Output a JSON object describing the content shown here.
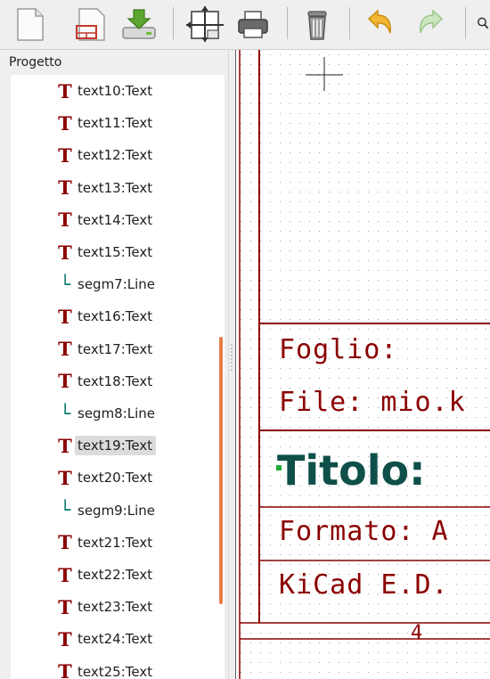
{
  "toolbar": {
    "buttons": [
      {
        "name": "new-page-icon",
        "title": "Nuovo"
      },
      {
        "name": "new-sheet-icon",
        "title": "Nuova pagina"
      },
      {
        "name": "download-icon",
        "title": "Carica"
      },
      {
        "name": "page-settings-icon",
        "title": "Impostazioni pagina"
      },
      {
        "name": "print-icon",
        "title": "Stampa"
      },
      {
        "name": "trash-icon",
        "title": "Elimina"
      },
      {
        "name": "undo-icon",
        "title": "Annulla"
      },
      {
        "name": "redo-icon",
        "title": "Ripeti"
      },
      {
        "name": "zoom-icon",
        "title": "Zoom"
      }
    ]
  },
  "panel": {
    "title": "Progetto",
    "items": [
      {
        "kind": "text",
        "label": "text10:Text"
      },
      {
        "kind": "text",
        "label": "text11:Text"
      },
      {
        "kind": "text",
        "label": "text12:Text"
      },
      {
        "kind": "text",
        "label": "text13:Text"
      },
      {
        "kind": "text",
        "label": "text14:Text"
      },
      {
        "kind": "text",
        "label": "text15:Text"
      },
      {
        "kind": "line",
        "label": "segm7:Line"
      },
      {
        "kind": "text",
        "label": "text16:Text"
      },
      {
        "kind": "text",
        "label": "text17:Text"
      },
      {
        "kind": "text",
        "label": "text18:Text"
      },
      {
        "kind": "line",
        "label": "segm8:Line"
      },
      {
        "kind": "text",
        "label": "text19:Text",
        "selected": true
      },
      {
        "kind": "text",
        "label": "text20:Text"
      },
      {
        "kind": "line",
        "label": "segm9:Line"
      },
      {
        "kind": "text",
        "label": "text21:Text"
      },
      {
        "kind": "text",
        "label": "text22:Text"
      },
      {
        "kind": "text",
        "label": "text23:Text"
      },
      {
        "kind": "text",
        "label": "text24:Text"
      },
      {
        "kind": "text",
        "label": "text25:Text"
      }
    ]
  },
  "canvas": {
    "fields": {
      "foglio": "Foglio:",
      "file": "File: mio.k",
      "titolo": "Titolo:",
      "formato": "Formato: A",
      "kicad": "KiCad E.D.",
      "number": "4"
    },
    "colors": {
      "frame": "#8b0000",
      "selected_text": "#0f4f4a",
      "marker": "#1faa3a",
      "grid": "#9a9a9a"
    }
  }
}
